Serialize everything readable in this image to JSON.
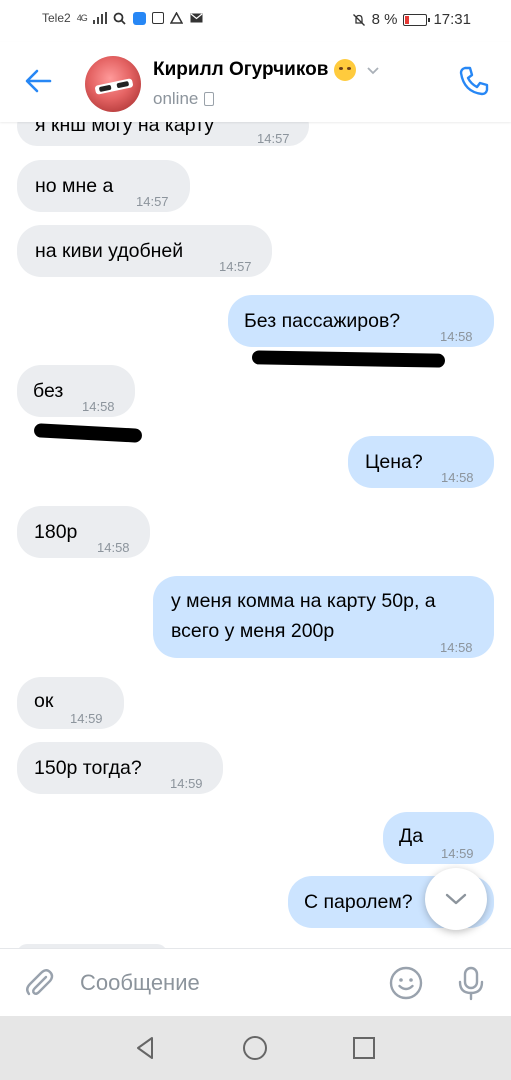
{
  "status_bar": {
    "carrier": "Tele2",
    "network": "4G",
    "battery": "8 %",
    "time": "17:31"
  },
  "header": {
    "contact_name": "Кирилл Огурчиков",
    "status": "online"
  },
  "messages": [
    {
      "dir": "in",
      "text": "я кнш могу на карту",
      "time": "14:57"
    },
    {
      "dir": "in",
      "text": "но мне а",
      "time": "14:57"
    },
    {
      "dir": "in",
      "text": "на киви удобней",
      "time": "14:57"
    },
    {
      "dir": "out",
      "text": "Без пассажиров?",
      "time": "14:58"
    },
    {
      "dir": "in",
      "text": "без",
      "time": "14:58"
    },
    {
      "dir": "out",
      "text": "Цена?",
      "time": "14:58"
    },
    {
      "dir": "in",
      "text": "180р",
      "time": "14:58"
    },
    {
      "dir": "out",
      "text": "у меня комма на карту 50р, а всего у меня 200р",
      "time": "14:58"
    },
    {
      "dir": "in",
      "text": "ок",
      "time": "14:59"
    },
    {
      "dir": "in",
      "text": "150р тогда?",
      "time": "14:59"
    },
    {
      "dir": "out",
      "text": "Да",
      "time": "14:59"
    },
    {
      "dir": "out",
      "text": "С паролем?",
      "time": ""
    }
  ],
  "composer": {
    "placeholder": "Сообщение"
  },
  "colors": {
    "accent": "#2787f5",
    "incoming_bubble": "#ebedf0",
    "outgoing_bubble": "#cce4ff",
    "time_text": "#8c949c"
  },
  "icons": [
    "back-arrow-icon",
    "phone-call-icon",
    "chevron-down-icon",
    "paperclip-icon",
    "smile-icon",
    "microphone-icon",
    "nav-back-icon",
    "nav-home-icon",
    "nav-recents-icon"
  ]
}
